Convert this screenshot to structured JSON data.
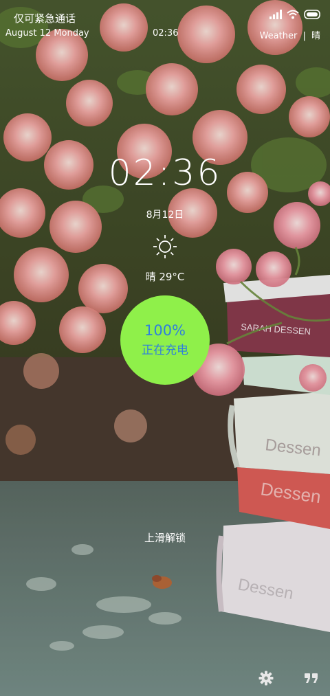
{
  "status_bar": {
    "emergency_text": "仅可紧急通话",
    "date_text": "August  12  Monday",
    "time": "02:36",
    "weather_label": "Weather",
    "weather_separator": "|",
    "weather_condition": "晴",
    "icons": [
      "signal-icon",
      "wifi-icon",
      "battery-icon"
    ]
  },
  "lock": {
    "clock": "02:36",
    "date": "8月12日",
    "weather_icon": "sun-icon",
    "weather_temp": "晴 29°C"
  },
  "charging": {
    "percent": "100%",
    "status": "正在充电",
    "level": 1.0,
    "circle_color": "#8ff04a",
    "text_color": "#2f7fdc"
  },
  "unlock_hint": "上滑解锁",
  "bottom_icons": [
    "gear-icon",
    "quote-icon"
  ],
  "wallpaper": {
    "book_labels": [
      "SARAH DESSEN",
      "Dessen",
      "Dessen",
      "Dessen"
    ]
  }
}
